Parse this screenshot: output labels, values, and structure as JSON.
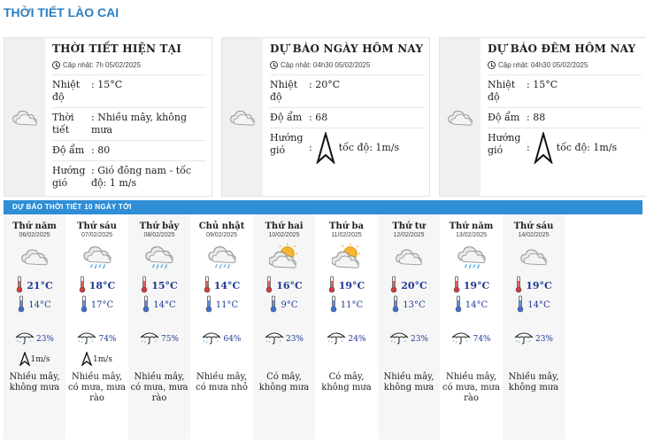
{
  "page_title": "THỜI TIẾT LÀO CAI",
  "current": {
    "title": "THỜI TIẾT HIỆN TẠI",
    "updated": "Cập nhật: 7h 05/02/2025",
    "rows": [
      {
        "k": "Nhiệt độ",
        "v": "15°C"
      },
      {
        "k": "Thời tiết",
        "v": "Nhiều mây, không mưa"
      },
      {
        "k": "Độ ẩm",
        "v": "80"
      },
      {
        "k": "Hướng gió",
        "v": "Gió đông nam - tốc độ: 1 m/s"
      }
    ],
    "icon": "cloudy-icon"
  },
  "today": {
    "title": "DỰ BÁO NGÀY HÔM NAY",
    "updated": "Cập nhật: 04h30 05/02/2025",
    "temp_k": "Nhiệt độ",
    "temp_v": "20°C",
    "hum_k": "Độ ẩm",
    "hum_v": "68",
    "wind_k": "Hướng gió",
    "wind_v": "tốc độ: 1m/s",
    "icon": "cloudy-icon"
  },
  "tonight": {
    "title": "DỰ BÁO ĐÊM HÔM NAY",
    "updated": "Cập nhật: 04h30 05/02/2025",
    "temp_k": "Nhiệt độ",
    "temp_v": "15°C",
    "hum_k": "Độ ẩm",
    "hum_v": "88",
    "wind_k": "Hướng gió",
    "wind_v": "tốc độ: 1m/s",
    "icon": "cloudy-icon"
  },
  "forecast_title": "DỰ BÁO THỜI TIẾT 10 NGÀY TỚI",
  "days": [
    {
      "name": "Thứ năm",
      "date": "06/02/2025",
      "icon": "cloudy",
      "hi": "21°C",
      "lo": "14°C",
      "rain": "23%",
      "wind": "1m/s",
      "desc": "Nhiều mây, không mưa"
    },
    {
      "name": "Thứ sáu",
      "date": "07/02/2025",
      "icon": "rain",
      "hi": "18°C",
      "lo": "17°C",
      "rain": "74%",
      "wind": "1m/s",
      "desc": "Nhiều mây, có mưa, mưa rào"
    },
    {
      "name": "Thứ bảy",
      "date": "08/02/2025",
      "icon": "rain",
      "hi": "15°C",
      "lo": "14°C",
      "rain": "75%",
      "wind": "",
      "desc": "Nhiều mây, có mưa, mưa rào"
    },
    {
      "name": "Chủ nhật",
      "date": "09/02/2025",
      "icon": "light-rain",
      "hi": "14°C",
      "lo": "11°C",
      "rain": "64%",
      "wind": "",
      "desc": "Nhiều mây, có mưa nhỏ"
    },
    {
      "name": "Thứ hai",
      "date": "10/02/2025",
      "icon": "partly-sunny",
      "hi": "16°C",
      "lo": "9°C",
      "rain": "23%",
      "wind": "",
      "desc": "Có mây, không mưa"
    },
    {
      "name": "Thứ ba",
      "date": "11/02/2025",
      "icon": "partly-sunny",
      "hi": "19°C",
      "lo": "11°C",
      "rain": "24%",
      "wind": "",
      "desc": "Có mây, không mưa"
    },
    {
      "name": "Thứ tư",
      "date": "12/02/2025",
      "icon": "cloudy",
      "hi": "20°C",
      "lo": "13°C",
      "rain": "23%",
      "wind": "",
      "desc": "Nhiều mây, không mưa"
    },
    {
      "name": "Thứ năm",
      "date": "13/02/2025",
      "icon": "rain",
      "hi": "19°C",
      "lo": "14°C",
      "rain": "74%",
      "wind": "",
      "desc": "Nhiều mây, có mưa, mưa rào"
    },
    {
      "name": "Thứ sáu",
      "date": "14/02/2025",
      "icon": "cloudy",
      "hi": "19°C",
      "lo": "14°C",
      "rain": "23%",
      "wind": "",
      "desc": "Nhiều mây, không mưa"
    }
  ]
}
